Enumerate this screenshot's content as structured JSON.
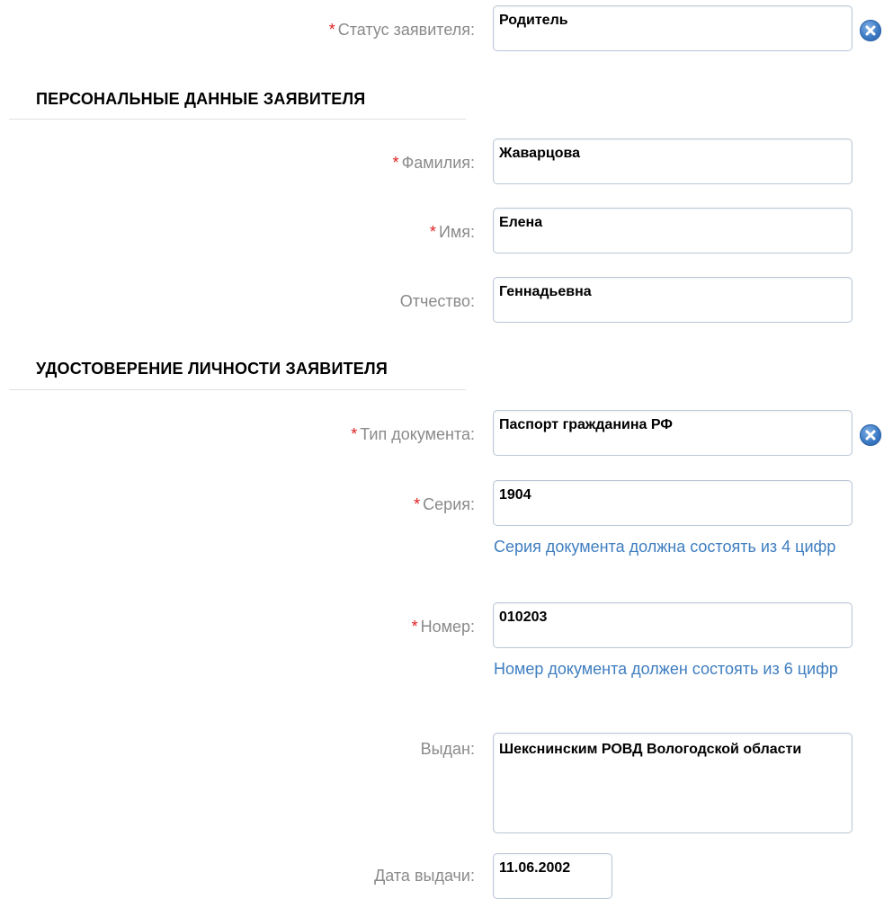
{
  "applicant_status": {
    "label": "Статус заявителя:",
    "required_mark": "*",
    "value": "Родитель"
  },
  "personal_section": {
    "title": "ПЕРСОНАЛЬНЫЕ ДАННЫЕ ЗАЯВИТЕЛЯ",
    "surname": {
      "label": "Фамилия:",
      "required_mark": "*",
      "value": "Жаварцова"
    },
    "name": {
      "label": "Имя:",
      "required_mark": "*",
      "value": "Елена"
    },
    "patronymic": {
      "label": "Отчество:",
      "value": "Геннадьевна"
    }
  },
  "identity_section": {
    "title": "УДОСТОВЕРЕНИЕ ЛИЧНОСТИ ЗАЯВИТЕЛЯ",
    "document_type": {
      "label": "Тип документа:",
      "required_mark": "*",
      "value": "Паспорт гражданина РФ"
    },
    "series": {
      "label": "Серия:",
      "required_mark": "*",
      "value": "1904",
      "hint": "Серия документа должна состоять из 4 цифр"
    },
    "number": {
      "label": "Номер:",
      "required_mark": "*",
      "value": "010203",
      "hint": "Номер документа должен состоять из 6 цифр"
    },
    "issued_by": {
      "label": "Выдан:",
      "value": "Шекснинским РОВД Вологодской области"
    },
    "issue_date": {
      "label": "Дата выдачи:",
      "value": "11.06.2002"
    }
  },
  "icons": {
    "clear": "clear-icon"
  },
  "colors": {
    "required": "#e02020",
    "label": "#8a8a8a",
    "hint": "#3f7ec0",
    "clear_button": "#3a78c4",
    "field_border": "#b9c7d6"
  }
}
